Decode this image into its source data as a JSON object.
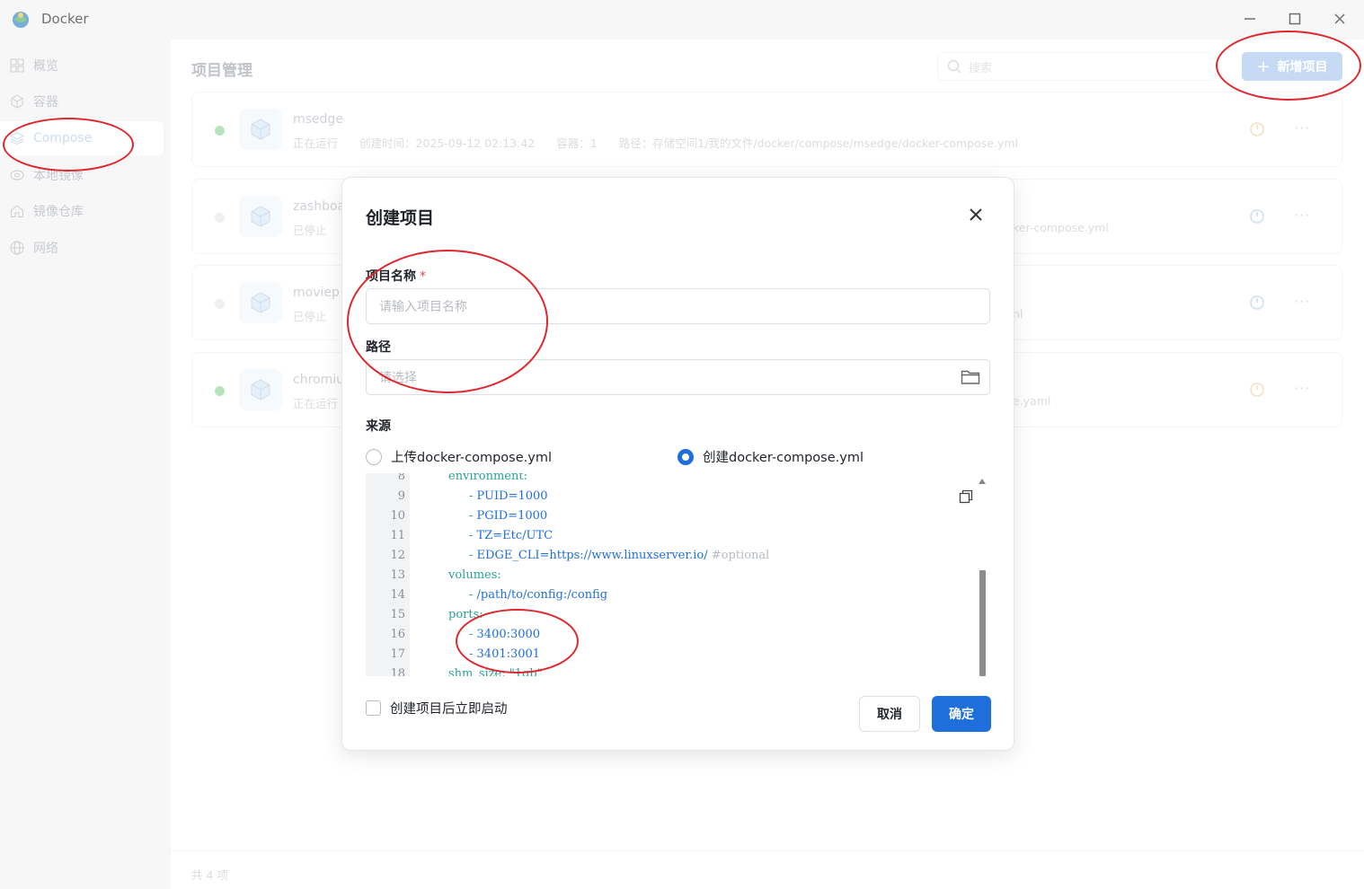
{
  "window": {
    "title": "Docker"
  },
  "sidebar": {
    "items": [
      {
        "label": "概览",
        "icon": "grid-icon"
      },
      {
        "label": "容器",
        "icon": "cube-icon"
      },
      {
        "label": "Compose",
        "icon": "layers-icon",
        "active": true
      },
      {
        "label": "本地镜像",
        "icon": "disk-icon"
      },
      {
        "label": "镜像仓库",
        "icon": "home-icon"
      },
      {
        "label": "网络",
        "icon": "globe-icon"
      }
    ]
  },
  "main": {
    "title": "项目管理",
    "search_placeholder": "搜索",
    "add_label": "新增项目",
    "projects": [
      {
        "name": "msedge",
        "status": "正在运行",
        "created": "创建时间：2025-09-12 02:13:42",
        "containers": "容器：1",
        "path": "路径：存储空间1/我的文件/docker/compose/msedge/docker-compose.yml",
        "path_tail": "",
        "running": true
      },
      {
        "name": "zashboa",
        "status": "已停止",
        "created": "",
        "containers": "",
        "path": "",
        "path_tail": "ker-compose.yml",
        "running": false
      },
      {
        "name": "moviep",
        "status": "已停止",
        "created": "",
        "containers": "",
        "path": "",
        "path_tail": "nl",
        "running": false
      },
      {
        "name": "chromiu",
        "status": "正在运行",
        "created": "",
        "containers": "",
        "path": "",
        "path_tail": "e.yaml",
        "running": true
      }
    ],
    "total": "共 4 项"
  },
  "dialog": {
    "title": "创建项目",
    "name_label": "项目名称",
    "required_mark": "*",
    "name_placeholder": "请输入项目名称",
    "path_label": "路径",
    "path_placeholder": "请选择",
    "source_label": "来源",
    "source_options": [
      {
        "label": "上传docker-compose.yml",
        "checked": false
      },
      {
        "label": "创建docker-compose.yml",
        "checked": true
      }
    ],
    "code_lines": [
      {
        "n": "8",
        "text": "environment:",
        "kind": "key",
        "indent": 0
      },
      {
        "n": "9",
        "text": "- PUID=1000",
        "kind": "item",
        "indent": 1
      },
      {
        "n": "10",
        "text": "- PGID=1000",
        "kind": "item",
        "indent": 1
      },
      {
        "n": "11",
        "text": "- TZ=Etc/UTC",
        "kind": "item",
        "indent": 1
      },
      {
        "n": "12",
        "text": "- EDGE_CLI=https://www.linuxserver.io/",
        "comment": " #optional",
        "kind": "item",
        "indent": 1
      },
      {
        "n": "13",
        "text": "volumes:",
        "kind": "key",
        "indent": 0
      },
      {
        "n": "14",
        "text": "- /path/to/config:/config",
        "kind": "item",
        "indent": 1
      },
      {
        "n": "15",
        "text": "ports:",
        "kind": "key",
        "indent": 0
      },
      {
        "n": "16",
        "text": "- 3400:3000",
        "kind": "item",
        "indent": 1
      },
      {
        "n": "17",
        "text": "- 3401:3001",
        "kind": "item",
        "indent": 1
      },
      {
        "n": "18",
        "text": "shm_size: \"1gb\"",
        "kind": "key",
        "indent": 0
      }
    ],
    "autostart_label": "创建项目后立即启动",
    "cancel_label": "取消",
    "ok_label": "确定"
  },
  "colors": {
    "accent": "#1e6fdc",
    "running": "#52c41a",
    "stopped": "#d9d9d9",
    "annotation": "#e0262d"
  }
}
